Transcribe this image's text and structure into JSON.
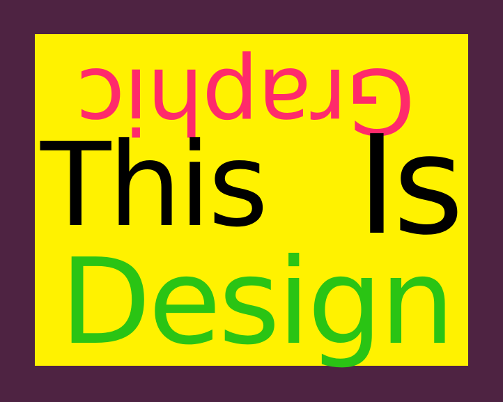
{
  "poster": {
    "background_color": "#4e2342",
    "panel_color": "#fff200",
    "words": {
      "graphic": {
        "text": "Graphic",
        "color": "#ff2a6b",
        "orientation": "upside-down"
      },
      "this": {
        "text": "This",
        "color": "#000000"
      },
      "is": {
        "text": "Is",
        "color": "#000000"
      },
      "design": {
        "text": "Design",
        "color": "#2ac414"
      }
    }
  }
}
